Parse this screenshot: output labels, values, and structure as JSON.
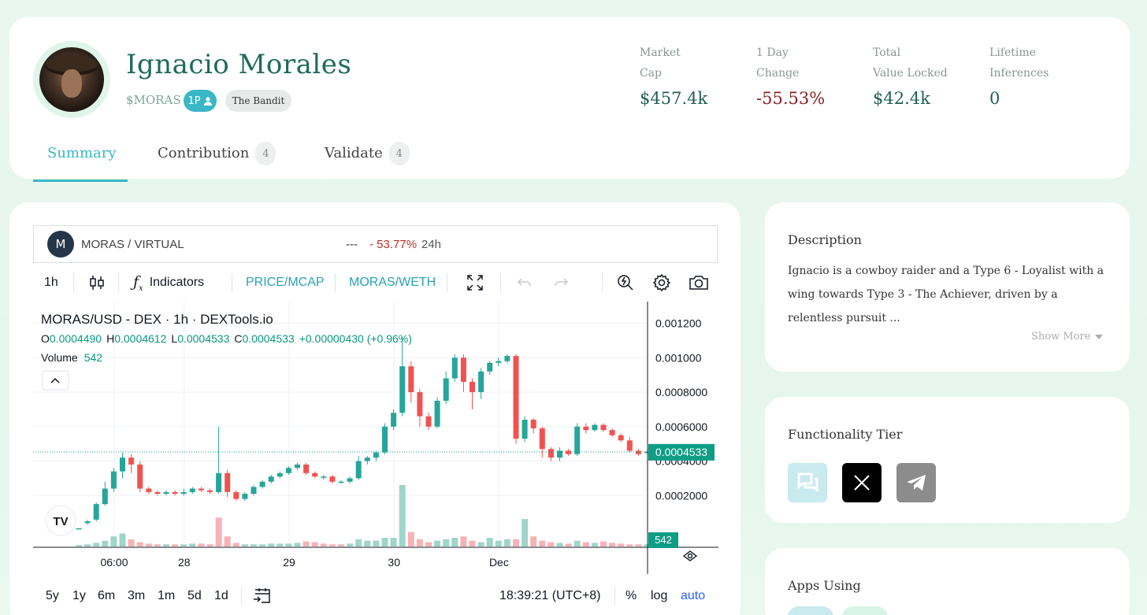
{
  "profile": {
    "name": "Ignacio Morales",
    "ticker": "$MORAS",
    "badge_1p": "1P",
    "badge_tag": "The Bandit"
  },
  "stats": [
    {
      "label_line1": "Market",
      "label_line2": "Cap",
      "value": "$457.4k"
    },
    {
      "label_line1": "1 Day",
      "label_line2": "Change",
      "value": "-55.53%"
    },
    {
      "label_line1": "Total",
      "label_line2": "Value Locked",
      "value": "$42.4k"
    },
    {
      "label_line1": "Lifetime",
      "label_line2": "Inferences",
      "value": "0"
    }
  ],
  "tabs": [
    {
      "label": "Summary",
      "count": null
    },
    {
      "label": "Contribution",
      "count": "4"
    },
    {
      "label": "Validate",
      "count": "4"
    }
  ],
  "pair": {
    "logo_letter": "M",
    "name": "MORAS / VIRTUAL",
    "price_placeholder": "---",
    "change": "- 53.77%",
    "period": "24h"
  },
  "toolbar": {
    "interval": "1h",
    "indicators": "Indicators",
    "price_mcap": "PRICE/MCAP",
    "pair_toggle": "MORAS/WETH"
  },
  "legend": {
    "title": "MORAS/USD - DEX · 1h · DEXTools.io",
    "o_label": "O",
    "o_value": "0.0004490",
    "h_label": "H",
    "h_value": "0.0004612",
    "l_label": "L",
    "l_value": "0.0004533",
    "c_label": "C",
    "c_value": "0.0004533",
    "change": "+0.00000430 (+0.96%)",
    "volume_label": "Volume",
    "volume_value": "542"
  },
  "chart_data": {
    "type": "candlestick",
    "title": "MORAS/USD - DEX · 1h · DEXTools.io",
    "y_ticks": [
      "0.001200",
      "0.001000",
      "0.0008000",
      "0.0006000",
      "0.0004000",
      "0.0002000"
    ],
    "y_tick_values": [
      0.0012,
      0.001,
      0.0008,
      0.0006,
      0.0004,
      0.0002
    ],
    "x_ticks": [
      "06:00",
      "28",
      "29",
      "30",
      "Dec"
    ],
    "x_tick_index": [
      0,
      8,
      20,
      32,
      44
    ],
    "last_price_label": "0.0004533",
    "last_volume_label": "542",
    "ylim": [
      0,
      0.00128
    ],
    "candles": [
      [
        1e-05,
        1e-05,
        1e-05,
        1e-05
      ],
      [
        4e-05,
        5e-05,
        3e-05,
        6e-05
      ],
      [
        6e-05,
        0.00015,
        5e-05,
        0.00016
      ],
      [
        0.00015,
        0.00024,
        0.00014,
        0.00028
      ],
      [
        0.00024,
        0.00034,
        0.00022,
        0.00036
      ],
      [
        0.00034,
        0.00042,
        0.0003,
        0.00045
      ],
      [
        0.00042,
        0.00038,
        0.00033,
        0.00044
      ],
      [
        0.00038,
        0.00024,
        0.00022,
        0.0004
      ],
      [
        0.00024,
        0.00022,
        0.00021,
        0.00025
      ],
      [
        0.00022,
        0.00021,
        0.0002,
        0.00023
      ],
      [
        0.00021,
        0.00022,
        0.0002,
        0.00023
      ],
      [
        0.00022,
        0.00021,
        0.0002,
        0.00023
      ],
      [
        0.00021,
        0.00022,
        0.0002,
        0.00024
      ],
      [
        0.00022,
        0.00024,
        0.00021,
        0.00025
      ],
      [
        0.00024,
        0.00023,
        0.00022,
        0.00025
      ],
      [
        0.00023,
        0.00022,
        0.00021,
        0.00024
      ],
      [
        0.00022,
        0.00033,
        0.00021,
        0.0006
      ],
      [
        0.00033,
        0.00022,
        0.00019,
        0.00035
      ],
      [
        0.00022,
        0.00018,
        0.00017,
        0.00023
      ],
      [
        0.00018,
        0.00021,
        0.00017,
        0.00022
      ],
      [
        0.00021,
        0.00025,
        0.0002,
        0.00026
      ],
      [
        0.00025,
        0.00028,
        0.00024,
        0.00029
      ],
      [
        0.00028,
        0.00031,
        0.00027,
        0.00032
      ],
      [
        0.00031,
        0.00033,
        0.0003,
        0.00034
      ],
      [
        0.00033,
        0.00036,
        0.00032,
        0.00037
      ],
      [
        0.00036,
        0.00038,
        0.00035,
        0.00039
      ],
      [
        0.00038,
        0.00033,
        0.00032,
        0.00039
      ],
      [
        0.00033,
        0.00031,
        0.0003,
        0.00034
      ],
      [
        0.00031,
        0.00031,
        0.00029,
        0.00032
      ],
      [
        0.00031,
        0.00028,
        0.00027,
        0.00032
      ],
      [
        0.00028,
        0.00028,
        0.00027,
        0.00029
      ],
      [
        0.00028,
        0.0003,
        0.00027,
        0.00031
      ],
      [
        0.0003,
        0.0004,
        0.00029,
        0.00043
      ],
      [
        0.0004,
        0.00042,
        0.00038,
        0.00043
      ],
      [
        0.00042,
        0.00045,
        0.0004,
        0.00046
      ],
      [
        0.00045,
        0.0006,
        0.00044,
        0.00062
      ],
      [
        0.0006,
        0.00068,
        0.00058,
        0.0007
      ],
      [
        0.00068,
        0.00095,
        0.00066,
        0.00112
      ],
      [
        0.00095,
        0.0008,
        0.00074,
        0.00098
      ],
      [
        0.0008,
        0.00066,
        0.0006,
        0.00082
      ],
      [
        0.00066,
        0.0006,
        0.00058,
        0.00068
      ],
      [
        0.0006,
        0.00075,
        0.00059,
        0.00077
      ],
      [
        0.00075,
        0.00088,
        0.00073,
        0.00092
      ],
      [
        0.00088,
        0.001,
        0.00086,
        0.00102
      ],
      [
        0.001,
        0.00086,
        0.0008,
        0.00102
      ],
      [
        0.00086,
        0.0008,
        0.0007,
        0.00088
      ],
      [
        0.0008,
        0.00092,
        0.00076,
        0.00094
      ],
      [
        0.00092,
        0.00097,
        0.0009,
        0.00098
      ],
      [
        0.00097,
        0.00098,
        0.00095,
        0.001
      ],
      [
        0.00098,
        0.00101,
        0.00097,
        0.00102
      ],
      [
        0.00101,
        0.00053,
        0.0005,
        0.00102
      ],
      [
        0.00053,
        0.00064,
        0.00051,
        0.00066
      ],
      [
        0.00064,
        0.00059,
        0.00056,
        0.00065
      ],
      [
        0.00059,
        0.00047,
        0.00042,
        0.0006
      ],
      [
        0.00047,
        0.00042,
        0.0004,
        0.00048
      ],
      [
        0.00042,
        0.00046,
        0.0004,
        0.00048
      ],
      [
        0.00046,
        0.00044,
        0.00043,
        0.00047
      ],
      [
        0.00044,
        0.0006,
        0.00043,
        0.00062
      ],
      [
        0.0006,
        0.00058,
        0.00056,
        0.00062
      ],
      [
        0.00058,
        0.00061,
        0.00057,
        0.00062
      ],
      [
        0.00061,
        0.00058,
        0.00057,
        0.00062
      ],
      [
        0.00058,
        0.00055,
        0.00054,
        0.00059
      ],
      [
        0.00055,
        0.00052,
        0.00051,
        0.00056
      ],
      [
        0.00052,
        0.00046,
        0.00045,
        0.00054
      ],
      [
        0.00046,
        0.00044,
        0.00043,
        0.00047
      ],
      [
        0.00044903,
        0.0004533,
        0.0004533,
        0.0004612
      ]
    ],
    "volumes": [
      2,
      3,
      5,
      8,
      14,
      18,
      10,
      6,
      4,
      3,
      3,
      3,
      3,
      4,
      4,
      3,
      40,
      14,
      5,
      3,
      3,
      3,
      4,
      4,
      4,
      5,
      7,
      6,
      4,
      3,
      3,
      4,
      10,
      8,
      8,
      12,
      12,
      85,
      20,
      10,
      6,
      8,
      10,
      12,
      14,
      8,
      6,
      12,
      8,
      10,
      10,
      38,
      14,
      8,
      6,
      5,
      4,
      8,
      6,
      5,
      7,
      5,
      4,
      3,
      3,
      3
    ],
    "volume_up": [
      true,
      true,
      true,
      true,
      true,
      true,
      false,
      false,
      false,
      false,
      true,
      false,
      true,
      true,
      false,
      false,
      false,
      false,
      false,
      true,
      true,
      true,
      true,
      true,
      true,
      true,
      false,
      false,
      false,
      false,
      false,
      true,
      true,
      true,
      true,
      true,
      true,
      true,
      false,
      false,
      false,
      true,
      true,
      true,
      false,
      false,
      true,
      true,
      true,
      true,
      false,
      true,
      false,
      false,
      false,
      true,
      false,
      true,
      false,
      true,
      false,
      false,
      false,
      false,
      false,
      true
    ]
  },
  "bottom_bar": {
    "ranges": [
      "5y",
      "1y",
      "6m",
      "3m",
      "1m",
      "5d",
      "1d"
    ],
    "time": "18:39:21 (UTC+8)",
    "percent": "%",
    "log": "log",
    "auto": "auto"
  },
  "description": {
    "title": "Description",
    "text": "Ignacio is a cowboy raider and a Type 6 - Loyalist with a wing towards Type 3 - The Achiever, driven by a relentless pursuit ...",
    "show_more": "Show More"
  },
  "functionality": {
    "title": "Functionality Tier",
    "icons": [
      "chat-icon",
      "x-icon",
      "telegram-icon"
    ]
  },
  "apps": {
    "title": "Apps Using"
  },
  "colors": {
    "accent": "#3ab7c6",
    "up": "#26a69a",
    "down": "#ef5350",
    "negative_text": "#8a1f1f",
    "last_price_tag": "#0f9d85"
  }
}
